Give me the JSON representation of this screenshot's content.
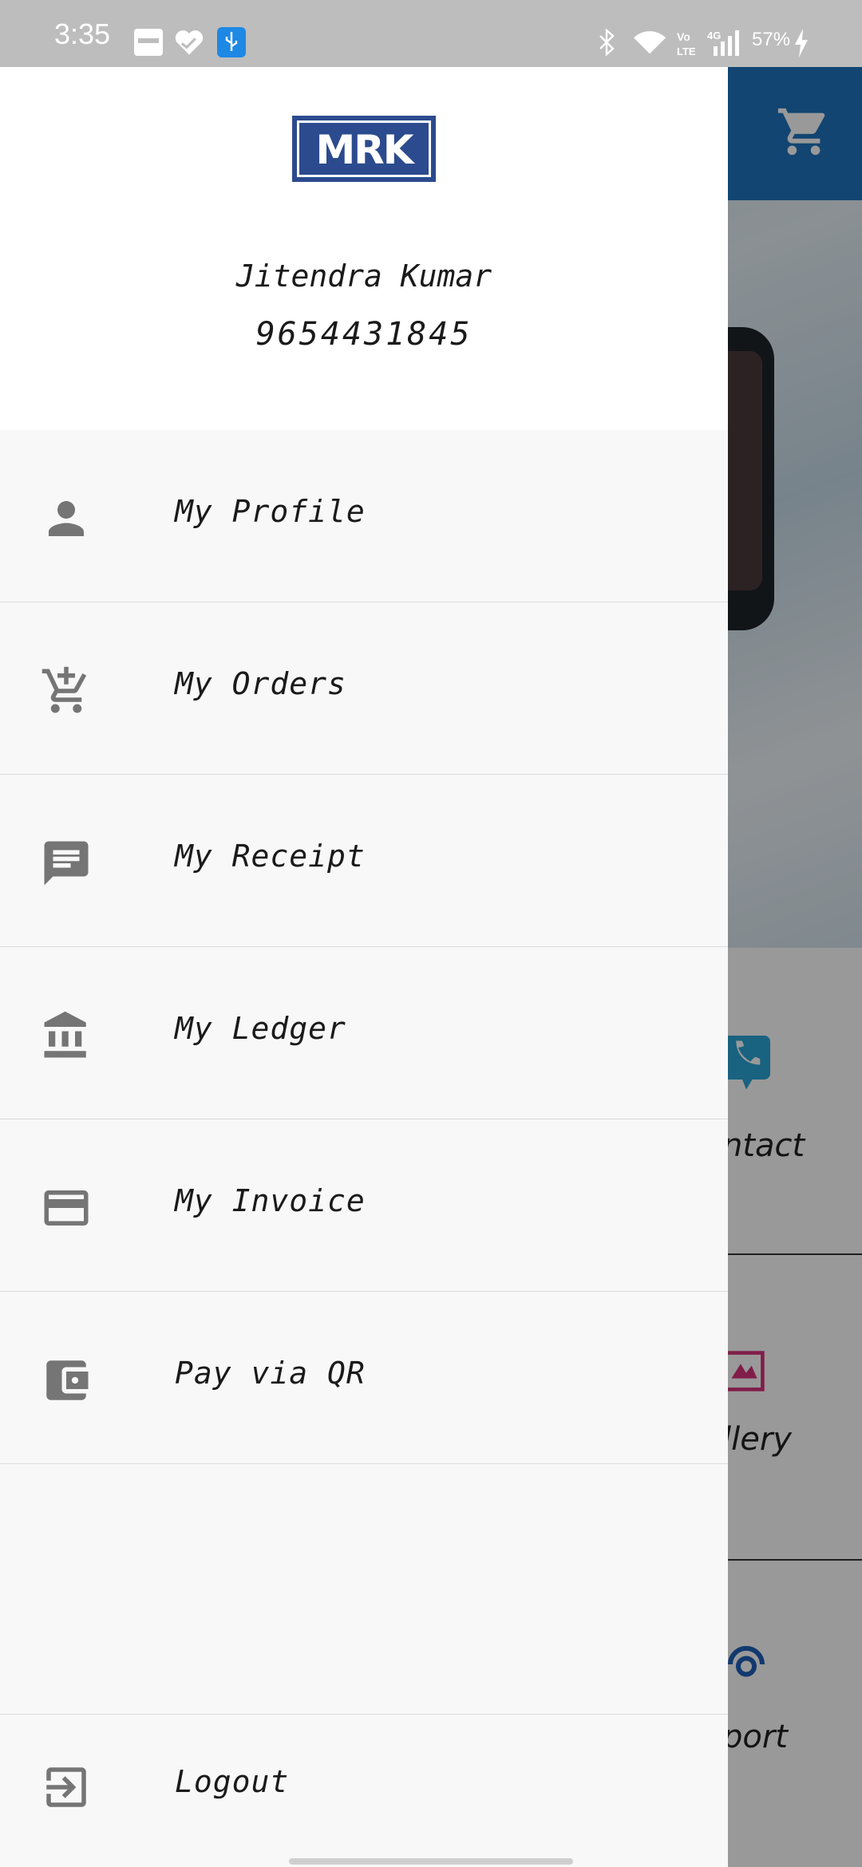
{
  "status_bar": {
    "time": "3:35",
    "battery": "57%",
    "icons": [
      "paytm-icon",
      "health-icon",
      "usb-icon",
      "bluetooth-icon",
      "wifi-icon",
      "volte-icon",
      "signal-4g-icon",
      "charging-icon"
    ]
  },
  "drawer": {
    "logo_text": "MRK",
    "user_name": "Jitendra Kumar",
    "user_phone": "9654431845",
    "items": [
      {
        "label": "My Profile",
        "icon": "person-icon"
      },
      {
        "label": "My Orders",
        "icon": "add-cart-icon"
      },
      {
        "label": "My Receipt",
        "icon": "message-icon"
      },
      {
        "label": "My Ledger",
        "icon": "bank-icon"
      },
      {
        "label": "My Invoice",
        "icon": "credit-card-icon"
      },
      {
        "label": "Pay via QR",
        "icon": "wallet-icon"
      }
    ],
    "logout": {
      "label": "Logout",
      "icon": "logout-icon"
    }
  },
  "background": {
    "tiles": [
      "ntact",
      "llery",
      "port"
    ]
  },
  "colors": {
    "toolbar": "#1f74bf",
    "logo_bg": "#2c4b8e",
    "icon_gray": "#757575",
    "drawer_bg": "#f8f8f8"
  }
}
